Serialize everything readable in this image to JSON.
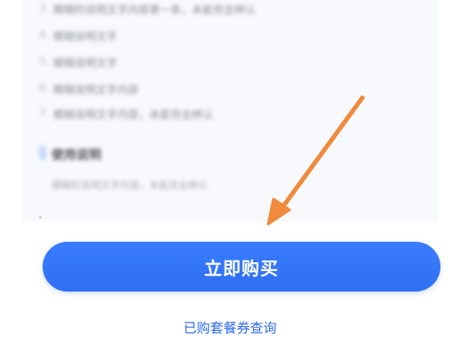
{
  "list_items": [
    {
      "num": "3.",
      "text": "模糊的说明文字内容第一条，未能完全辨认"
    },
    {
      "num": "4.",
      "text": "模糊说明文字"
    },
    {
      "num": "5.",
      "text": "模糊说明文字"
    },
    {
      "num": "6.",
      "text": "模糊说明文字内容"
    },
    {
      "num": "7.",
      "text": "模糊说明文字内容，未能完全辨认"
    }
  ],
  "section": {
    "title": "使用说明",
    "description": "模糊的说明文字内容，未能完全辨认"
  },
  "buy_button": {
    "label": "立即购买"
  },
  "query_link": {
    "label": "已购套餐券查询"
  },
  "colors": {
    "accent": "#2f6ff2",
    "arrow": "#f08a3c",
    "link": "#2c6ae8"
  }
}
